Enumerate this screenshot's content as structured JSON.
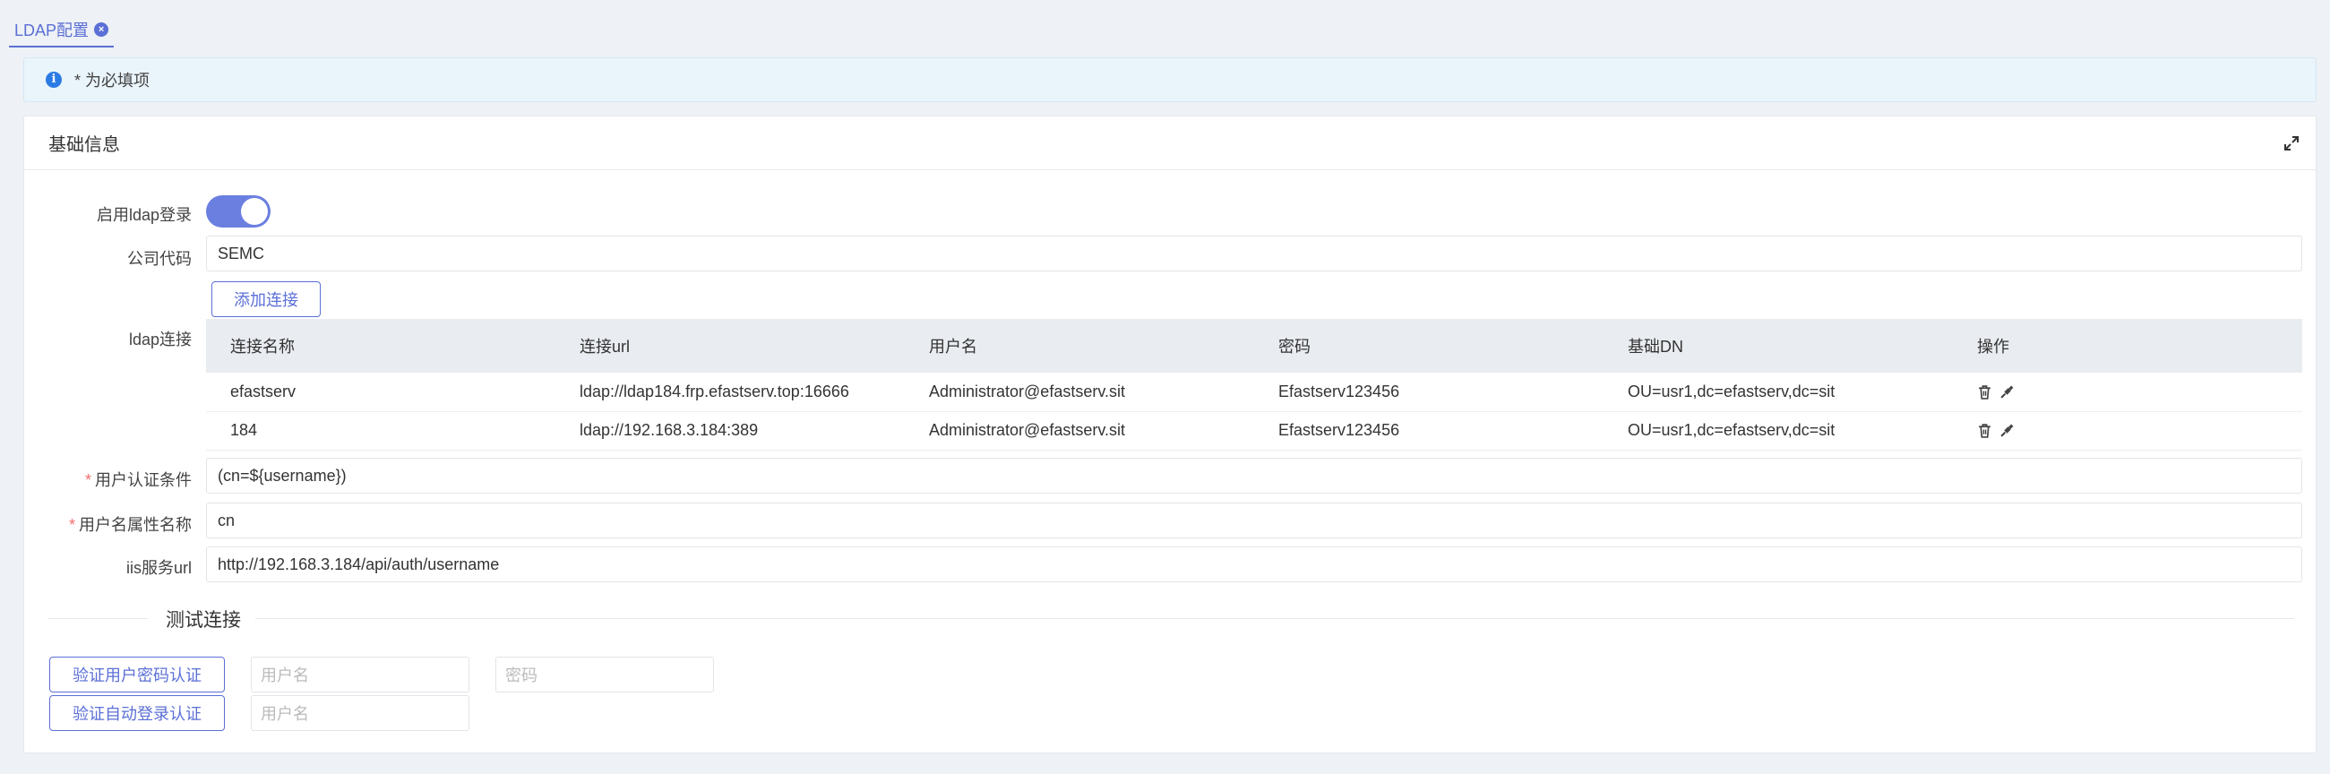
{
  "tab": {
    "label": "LDAP配置"
  },
  "notice": {
    "text": "* 为必填项"
  },
  "panel": {
    "title": "基础信息"
  },
  "form": {
    "enable_label": "启用ldap登录",
    "company_label": "公司代码",
    "company_value": "SEMC",
    "ldap_label": "ldap连接",
    "add_conn_label": "添加连接",
    "auth_label": "用户认证条件",
    "auth_value": "(cn=${username})",
    "username_attr_label": "用户名属性名称",
    "username_attr_value": "cn",
    "iis_label": "iis服务url",
    "iis_value": "http://192.168.3.184/api/auth/username",
    "required_mark": "*",
    "enable_on": true
  },
  "table": {
    "headers": [
      "连接名称",
      "连接url",
      "用户名",
      "密码",
      "基础DN",
      "操作"
    ],
    "rows": [
      [
        "efastserv",
        "ldap://ldap184.frp.efastserv.top:16666",
        "Administrator@efastserv.sit",
        "Efastserv123456",
        "OU=usr1,dc=efastserv,dc=sit"
      ],
      [
        "184",
        "ldap://192.168.3.184:389",
        "Administrator@efastserv.sit",
        "Efastserv123456",
        "OU=usr1,dc=efastserv,dc=sit"
      ]
    ]
  },
  "test": {
    "title": "测试连接",
    "verify_pwd_label": "验证用户密码认证",
    "verify_auto_label": "验证自动登录认证",
    "username_placeholder": "用户名",
    "password_placeholder": "密码"
  },
  "colors": {
    "accent": "#5b6fd6",
    "required": "#f56c6c",
    "info": "#2c7be5"
  },
  "icons": [
    "info-icon",
    "close-circle-icon",
    "expand-icon",
    "trash-icon",
    "plug-icon"
  ]
}
